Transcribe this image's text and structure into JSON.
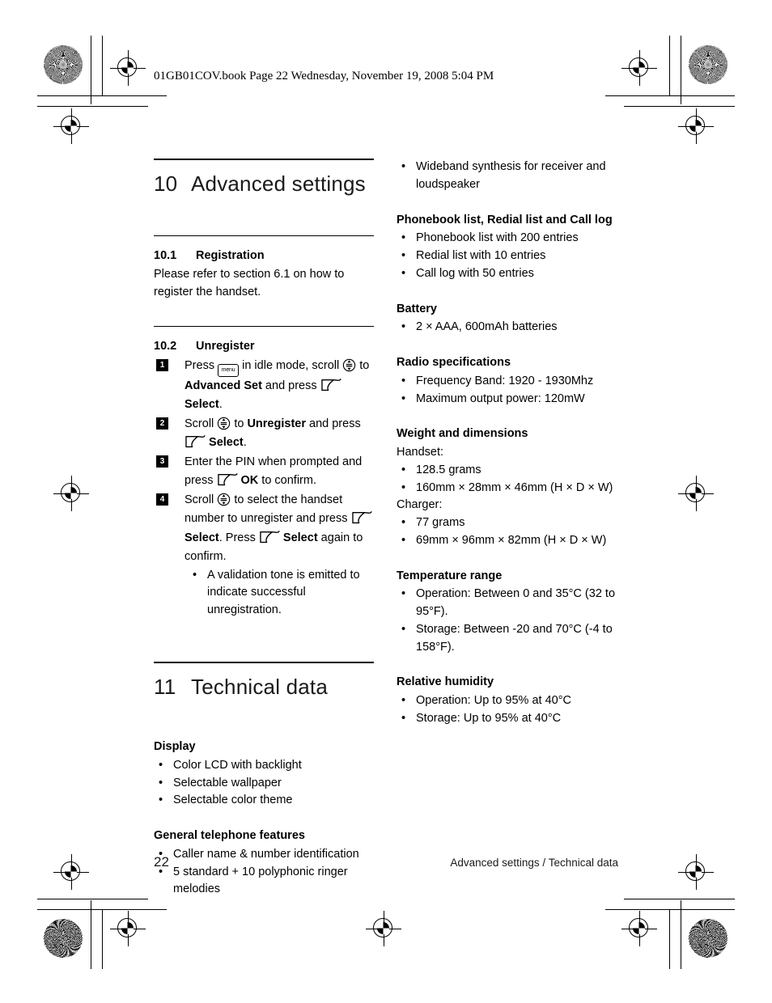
{
  "running_header": "01GB01COV.book  Page 22  Wednesday, November 19, 2008  5:04 PM",
  "icons": {
    "menu_label": "menu",
    "scroll_label": "scroll-key-icon",
    "softkey_label": "soft-key-icon"
  },
  "chapters": [
    {
      "number": "10",
      "title": "Advanced settings"
    },
    {
      "number": "11",
      "title": "Technical data"
    }
  ],
  "sections": {
    "registration": {
      "number": "10.1",
      "title": "Registration",
      "body": "Please refer to section 6.1 on how to register the handset."
    },
    "unregister": {
      "number": "10.2",
      "title": "Unregister",
      "steps": [
        {
          "n": "1",
          "parts": [
            {
              "t": "text",
              "v": "Press "
            },
            {
              "t": "icon",
              "v": "menu"
            },
            {
              "t": "text",
              "v": " in idle mode, scroll "
            },
            {
              "t": "icon",
              "v": "scroll"
            },
            {
              "t": "text",
              "v": " to "
            },
            {
              "t": "bold",
              "v": "Advanced Set"
            },
            {
              "t": "text",
              "v": " and press "
            },
            {
              "t": "icon",
              "v": "soft"
            },
            {
              "t": "text",
              "v": " "
            },
            {
              "t": "bold",
              "v": "Select"
            },
            {
              "t": "text",
              "v": "."
            }
          ]
        },
        {
          "n": "2",
          "parts": [
            {
              "t": "text",
              "v": "Scroll "
            },
            {
              "t": "icon",
              "v": "scroll"
            },
            {
              "t": "text",
              "v": " to "
            },
            {
              "t": "bold",
              "v": "Unregister"
            },
            {
              "t": "text",
              "v": " and press "
            },
            {
              "t": "icon",
              "v": "soft"
            },
            {
              "t": "text",
              "v": " "
            },
            {
              "t": "bold",
              "v": "Select"
            },
            {
              "t": "text",
              "v": "."
            }
          ]
        },
        {
          "n": "3",
          "parts": [
            {
              "t": "text",
              "v": "Enter the PIN when prompted and press "
            },
            {
              "t": "icon",
              "v": "soft"
            },
            {
              "t": "text",
              "v": " "
            },
            {
              "t": "bold",
              "v": "OK"
            },
            {
              "t": "text",
              "v": " to confirm."
            }
          ]
        },
        {
          "n": "4",
          "parts": [
            {
              "t": "text",
              "v": "Scroll "
            },
            {
              "t": "icon",
              "v": "scroll"
            },
            {
              "t": "text",
              "v": " to select the handset number to unregister and press "
            },
            {
              "t": "icon",
              "v": "soft"
            },
            {
              "t": "text",
              "v": " "
            },
            {
              "t": "bold",
              "v": "Select"
            },
            {
              "t": "text",
              "v": ". Press "
            },
            {
              "t": "icon",
              "v": "soft"
            },
            {
              "t": "text",
              "v": " "
            },
            {
              "t": "bold",
              "v": "Select"
            },
            {
              "t": "text",
              "v": " again to confirm."
            }
          ],
          "subitems": [
            "A validation tone is emitted to indicate successful unregistration."
          ]
        }
      ]
    }
  },
  "spec_groups_left": [
    {
      "heading": "Display",
      "items": [
        "Color LCD with backlight",
        "Selectable wallpaper",
        "Selectable color theme"
      ]
    },
    {
      "heading": "General telephone features",
      "items": [
        "Caller name & number identification",
        "5 standard + 10 polyphonic ringer melodies"
      ]
    }
  ],
  "spec_groups_right": [
    {
      "heading": "",
      "items": [
        "Wideband synthesis for receiver and loudspeaker"
      ]
    },
    {
      "heading": "Phonebook list, Redial list and Call log",
      "items": [
        "Phonebook list with 200 entries",
        "Redial list with 10 entries",
        "Call log with 50 entries"
      ]
    },
    {
      "heading": "Battery",
      "items": [
        "2 × AAA, 600mAh batteries"
      ]
    },
    {
      "heading": "Radio specifications",
      "items": [
        "Frequency Band: 1920 - 1930Mhz",
        "Maximum output power: 120mW"
      ]
    },
    {
      "heading": "Weight and dimensions",
      "subgroups": [
        {
          "label": "Handset:",
          "items": [
            "128.5 grams",
            "160mm × 28mm × 46mm (H × D × W)"
          ]
        },
        {
          "label": "Charger:",
          "items": [
            "77 grams",
            "69mm × 96mm × 82mm (H × D × W)"
          ]
        }
      ]
    },
    {
      "heading": "Temperature range",
      "items": [
        "Operation: Between 0 and 35°C (32 to 95°F).",
        "Storage: Between -20 and 70°C (-4 to 158°F)."
      ]
    },
    {
      "heading": "Relative humidity",
      "items": [
        "Operation: Up to 95% at 40°C",
        "Storage: Up to 95% at 40°C"
      ]
    }
  ],
  "footer": {
    "page_number": "22",
    "running_foot": "Advanced settings / Technical data"
  }
}
